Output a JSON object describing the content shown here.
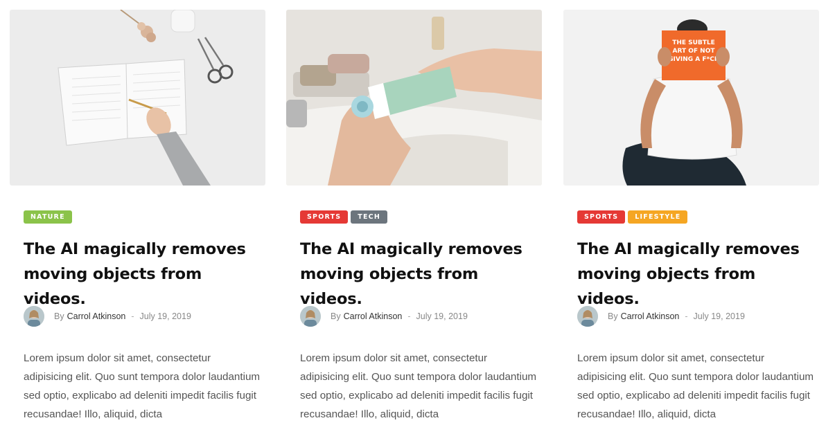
{
  "colors": {
    "nature": "#8bc34a",
    "sports": "#e53935",
    "tech": "#6c757d",
    "lifestyle": "#f5a623"
  },
  "cards": [
    {
      "image": "notebook-writing-photo",
      "tags": [
        {
          "label": "NATURE",
          "color": "#8bc34a"
        }
      ],
      "title": "The AI magically removes moving objects from videos.",
      "by": "By",
      "author": "Carrol Atkinson",
      "sep": "-",
      "date": "July 19, 2019",
      "excerpt": "Lorem ipsum dolor sit amet, consectetur adipisicing elit. Quo sunt tempora dolor laudantium sed optio, explicabo ad deleniti impedit facilis fugit recusandae! Illo, aliquid, dicta"
    },
    {
      "image": "soap-packaging-photo",
      "tags": [
        {
          "label": "SPORTS",
          "color": "#e53935"
        },
        {
          "label": "TECH",
          "color": "#6c757d"
        }
      ],
      "title": "The AI magically removes moving objects from videos.",
      "by": "By",
      "author": "Carrol Atkinson",
      "sep": "-",
      "date": "July 19, 2019",
      "excerpt": "Lorem ipsum dolor sit amet, consectetur adipisicing elit. Quo sunt tempora dolor laudantium sed optio, explicabo ad deleniti impedit facilis fugit recusandae! Illo, aliquid, dicta"
    },
    {
      "image": "man-reading-book-photo",
      "tags": [
        {
          "label": "SPORTS",
          "color": "#e53935"
        },
        {
          "label": "LIFESTYLE",
          "color": "#f5a623"
        }
      ],
      "title": "The AI magically removes moving objects from videos.",
      "by": "By",
      "author": "Carrol Atkinson",
      "sep": "-",
      "date": "July 19, 2019",
      "excerpt": "Lorem ipsum dolor sit amet, consectetur adipisicing elit. Quo sunt tempora dolor laudantium sed optio, explicabo ad deleniti impedit facilis fugit recusandae! Illo, aliquid, dicta",
      "book_cover_text": "THE SUBTLE ART OF NOT GIVING A F*CK"
    }
  ]
}
